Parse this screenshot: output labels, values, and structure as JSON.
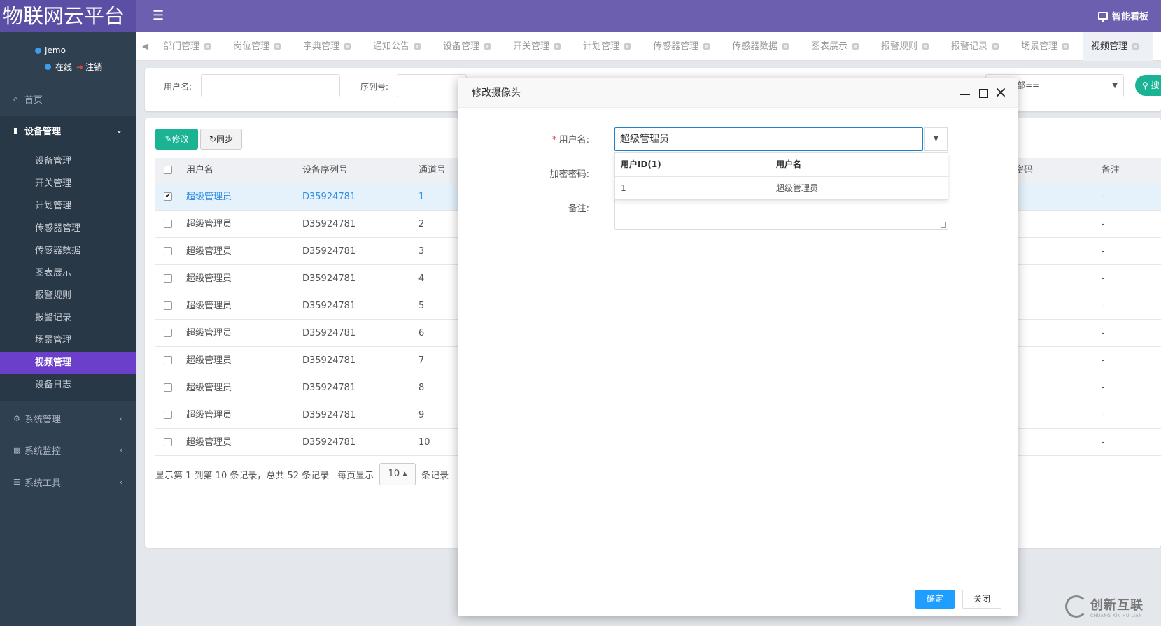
{
  "app": {
    "brand": "物联网云平台",
    "dashboard": "智能看板"
  },
  "user": {
    "name": "Jemo",
    "status": "在线",
    "logout": "注销"
  },
  "sidebar": {
    "home": "首页",
    "device_mgmt": "设备管理",
    "sub_items": [
      "设备管理",
      "开关管理",
      "计划管理",
      "传感器管理",
      "传感器数据",
      "图表展示",
      "报警规则",
      "报警记录",
      "场景管理",
      "视频管理",
      "设备日志"
    ],
    "system_mgmt": "系统管理",
    "system_monitor": "系统监控",
    "system_tools": "系统工具"
  },
  "tabs": [
    "部门管理",
    "岗位管理",
    "字典管理",
    "通知公告",
    "设备管理",
    "开关管理",
    "计划管理",
    "传感器管理",
    "传感器数据",
    "图表展示",
    "报警规则",
    "报警记录",
    "场景管理",
    "视频管理"
  ],
  "search": {
    "username_label": "用户名:",
    "serial_label": "序列号:",
    "select_value": "部==",
    "search_button": "搜"
  },
  "toolbar": {
    "edit": "修改",
    "sync": "同步"
  },
  "table": {
    "headers": [
      "用户名",
      "设备序列号",
      "通道号",
      "密码",
      "备注"
    ],
    "rows": [
      [
        "超级管理员",
        "D35924781",
        "1",
        "-"
      ],
      [
        "超级管理员",
        "D35924781",
        "2",
        "-"
      ],
      [
        "超级管理员",
        "D35924781",
        "3",
        "-"
      ],
      [
        "超级管理员",
        "D35924781",
        "4",
        "-"
      ],
      [
        "超级管理员",
        "D35924781",
        "5",
        "-"
      ],
      [
        "超级管理员",
        "D35924781",
        "6",
        "-"
      ],
      [
        "超级管理员",
        "D35924781",
        "7",
        "-"
      ],
      [
        "超级管理员",
        "D35924781",
        "8",
        "-"
      ],
      [
        "超级管理员",
        "D35924781",
        "9",
        "-"
      ],
      [
        "超级管理员",
        "D35924781",
        "10",
        "-"
      ]
    ]
  },
  "pager": {
    "text": "显示第 1 到第 10 条记录，总共 52 条记录",
    "per_page": "每页显示",
    "size": "10",
    "suffix": "条记录"
  },
  "modal": {
    "title": "修改摄像头",
    "username_label": "用户名:",
    "username_value": "超级管理员",
    "password_label": "加密密码:",
    "remark_label": "备注:",
    "dropdown_headers": [
      "用户ID(1)",
      "用户名"
    ],
    "dropdown_row": [
      "1",
      "超级管理员"
    ],
    "ok": "确定",
    "close": "关闭"
  },
  "watermark": {
    "cn": "创新互联",
    "en": "CHUANG XIN HU LIAN"
  }
}
